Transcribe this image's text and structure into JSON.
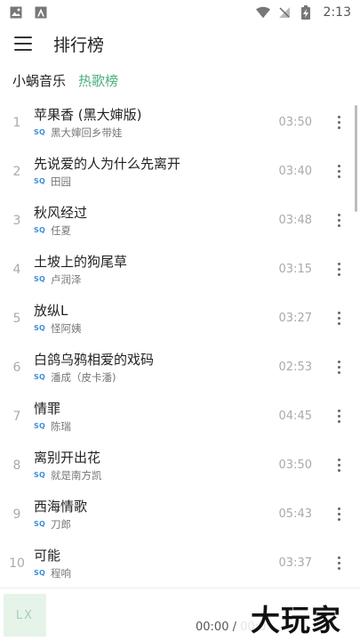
{
  "status_bar": {
    "time": "2:13"
  },
  "app_bar": {
    "title": "排行榜"
  },
  "tabs": [
    {
      "label": "小蜗音乐"
    },
    {
      "label": "热歌榜"
    }
  ],
  "songs": [
    {
      "index": "1",
      "title": "苹果香 (黑大婶版)",
      "quality": "SQ",
      "artist": "黑大婶回乡带娃",
      "duration": "03:50"
    },
    {
      "index": "2",
      "title": "先说爱的人为什么先离开",
      "quality": "SQ",
      "artist": "田园",
      "duration": "03:40"
    },
    {
      "index": "3",
      "title": "秋风经过",
      "quality": "SQ",
      "artist": "任夏",
      "duration": "03:48"
    },
    {
      "index": "4",
      "title": "土坡上的狗尾草",
      "quality": "SQ",
      "artist": "卢润泽",
      "duration": "03:15"
    },
    {
      "index": "5",
      "title": "放纵L",
      "quality": "SQ",
      "artist": "怪阿姨",
      "duration": "03:27"
    },
    {
      "index": "6",
      "title": "白鸽乌鸦相爱的戏码",
      "quality": "SQ",
      "artist": "潘成（皮卡潘)",
      "duration": "02:53"
    },
    {
      "index": "7",
      "title": "情罪",
      "quality": "SQ",
      "artist": "陈瑞",
      "duration": "04:45"
    },
    {
      "index": "8",
      "title": "离别开出花",
      "quality": "SQ",
      "artist": "就是南方凯",
      "duration": "03:50"
    },
    {
      "index": "9",
      "title": "西海情歌",
      "quality": "SQ",
      "artist": "刀郎",
      "duration": "05:43"
    },
    {
      "index": "10",
      "title": "可能",
      "quality": "SQ",
      "artist": "程响",
      "duration": "03:37"
    }
  ],
  "player": {
    "cover_text": "LX",
    "progress_text": "00:00 / 00:0"
  },
  "watermark": "大玩家",
  "colors": {
    "accent": "#4caf7d",
    "quality_badge": "#3a8fd8"
  }
}
